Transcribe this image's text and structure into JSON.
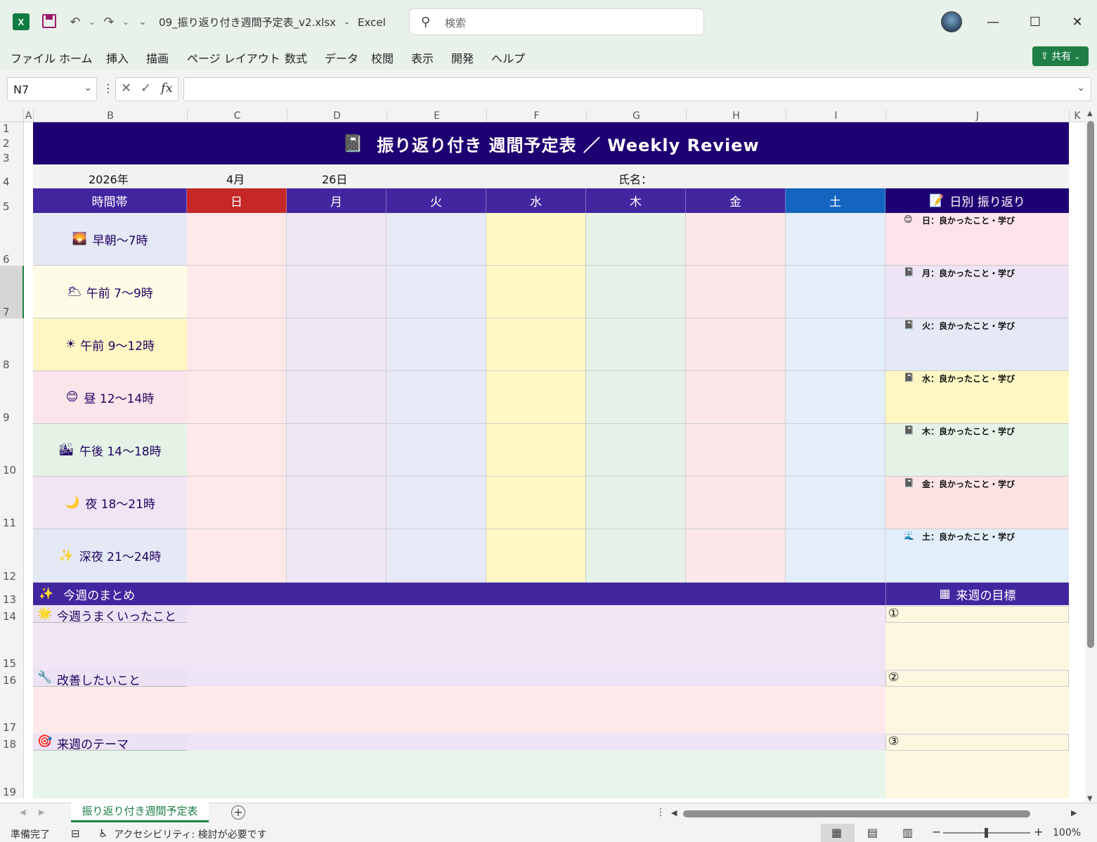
{
  "titlebar": {
    "app_icon": "excel-icon",
    "filename": "09_振り返り付き週間予定表_v2.xlsx",
    "separator": "-",
    "app_name": "Excel",
    "search_placeholder": "検索",
    "min": "—",
    "max": "☐",
    "close": "✕"
  },
  "menu": [
    "ファイル",
    "ホーム",
    "挿入",
    "描画",
    "ページ レイアウト",
    "数式",
    "データ",
    "校閲",
    "表示",
    "開発",
    "ヘルプ"
  ],
  "share_label": "共有",
  "formula_bar": {
    "name_box": "N7",
    "fx": "fx",
    "value": ""
  },
  "columns": [
    "A",
    "B",
    "C",
    "D",
    "E",
    "F",
    "G",
    "H",
    "I",
    "J",
    "K"
  ],
  "rows": [
    "1",
    "2",
    "3",
    "4",
    "5",
    "6",
    "7",
    "8",
    "9",
    "10",
    "11",
    "12",
    "13",
    "14",
    "15",
    "16",
    "17",
    "18",
    "19"
  ],
  "sheet": {
    "title": "振り返り付き 週間予定表 ／ Weekly Review",
    "title_icon": "📓",
    "year": "2026年",
    "month": "4月",
    "day": "26日",
    "name_label": "氏名：",
    "time_header": "時間帯",
    "days": [
      "日",
      "月",
      "火",
      "水",
      "木",
      "金",
      "土"
    ],
    "review_header": "日別 振り返り",
    "time_slots": [
      {
        "icon": "🌄",
        "label": "早朝～7時"
      },
      {
        "icon": "🌥",
        "label": "午前 7～9時"
      },
      {
        "icon": "☀",
        "label": "午前 9～12時"
      },
      {
        "icon": "😊",
        "label": "昼 12～14時"
      },
      {
        "icon": "🏙",
        "label": "午後 14～18時"
      },
      {
        "icon": "🌙",
        "label": "夜 18～21時"
      },
      {
        "icon": "✨",
        "label": "深夜 21～24時"
      }
    ],
    "daily_reviews": [
      {
        "icon": "😊",
        "label": "日：良かったこと・学び"
      },
      {
        "icon": "📓",
        "label": "月：良かったこと・学び"
      },
      {
        "icon": "📓",
        "label": "火：良かったこと・学び"
      },
      {
        "icon": "📓",
        "label": "水：良かったこと・学び"
      },
      {
        "icon": "📓",
        "label": "木：良かったこと・学び"
      },
      {
        "icon": "📓",
        "label": "金：良かったこと・学び"
      },
      {
        "icon": "🌊",
        "label": "土：良かったこと・学び"
      }
    ],
    "summary_header": "今週のまとめ",
    "goals_header": "来週の目標",
    "summary_items": [
      {
        "icon": "🌟",
        "label": "今週うまくいったこと"
      },
      {
        "icon": "🔧",
        "label": "改善したいこと"
      },
      {
        "icon": "🎯",
        "label": "来週のテーマ"
      }
    ],
    "goals": [
      "①",
      "②",
      "③"
    ]
  },
  "sheet_tab": "振り返り付き週間予定表",
  "status": {
    "ready": "準備完了",
    "accessibility": "アクセシビリティ: 検討が必要です",
    "zoom": "100%"
  },
  "colors": {
    "banner": "#1f0072",
    "header_purple": "#4226a0",
    "sunday_red": "#c62828",
    "saturday_blue": "#1565c0",
    "excel_green": "#1e7e45"
  }
}
